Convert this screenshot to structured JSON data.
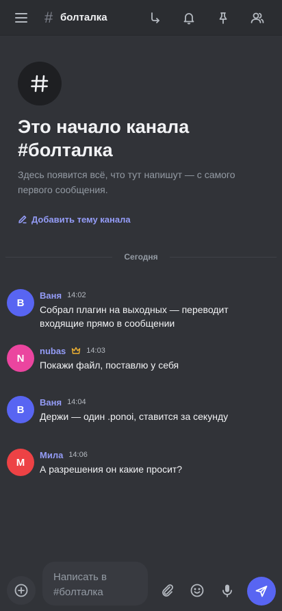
{
  "header": {
    "channel_hash": "#",
    "channel_name": "болталка"
  },
  "intro": {
    "icon_symbol": "#",
    "title": "Это начало канала #болталка",
    "subtitle": "Здесь появится всё, что тут напишут — с самого первого сообщения.",
    "add_topic_label": "Добавить тему канала"
  },
  "divider_label": "Сегодня",
  "messages": [
    {
      "author": "Ваня",
      "initial": "B",
      "time": "14:02",
      "text": "Собрал плагин на выходных — переводит входящие прямо в сообщении",
      "author_color": "#949cf7",
      "avatar_color": "#5865f2"
    },
    {
      "author": "nubas",
      "initial": "N",
      "time": "14:03",
      "text": "Покажи файл, поставлю у себя",
      "author_color": "#949cf7",
      "avatar_color": "#eb459f",
      "owner_crown": true
    },
    {
      "author": "Ваня",
      "initial": "B",
      "time": "14:04",
      "text": "Держи — один .ponoi, ставится за секунду",
      "author_color": "#949cf7",
      "avatar_color": "#5865f2"
    },
    {
      "author": "Мила",
      "initial": "M",
      "time": "14:06",
      "text": "А разрешения он какие просит?",
      "author_color": "#949cf7",
      "avatar_color": "#ed4245"
    }
  ],
  "composer": {
    "placeholder_line1": "Написать в",
    "placeholder_line2": "#болталка"
  },
  "colors": {
    "background": "#313338",
    "header": "#2b2d31",
    "accent": "#5865f2",
    "link": "#949cf7",
    "crown": "#f0b232"
  },
  "icons": [
    "menu-icon",
    "hash-icon",
    "threads-icon",
    "bell-icon",
    "pin-icon",
    "members-icon",
    "pencil-icon",
    "crown-icon",
    "plus-icon",
    "paperclip-icon",
    "emoji-icon",
    "microphone-icon",
    "send-icon"
  ]
}
